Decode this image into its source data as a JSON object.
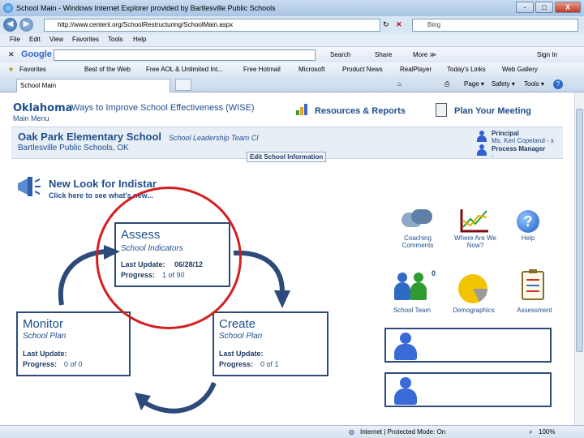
{
  "window": {
    "title": "School Main - Windows Internet Explorer provided by Bartlesville Public Schools",
    "min": "-",
    "max": "□",
    "close": "X"
  },
  "address": {
    "url": "http://www.centerii.org/SchoolRestructuring/SchoolMain.aspx",
    "search_placeholder": "Bing"
  },
  "menu": [
    "File",
    "Edit",
    "View",
    "Favorites",
    "Tools",
    "Help"
  ],
  "google": {
    "label": "Google",
    "search": "Search",
    "share": "Share",
    "more": "More ≫",
    "signin": "Sign In"
  },
  "favorites": {
    "label": "Favorites",
    "items": [
      "Best of the Web",
      "Free AOL & Unlimited Int...",
      "Free Hotmail",
      "Microsoft",
      "Product News",
      "RealPlayer",
      "Today's Links",
      "Web Gallery"
    ]
  },
  "tabs": {
    "active": "School Main",
    "page": "Page ▾",
    "safety": "Safety ▾",
    "tools": "Tools ▾",
    "help": "?"
  },
  "header": {
    "state": "Oklahoma",
    "tagline": "Ways to Improve School Effectiveness (WISE)",
    "main_menu": "Main Menu",
    "resources": "Resources & Reports",
    "plan": "Plan Your Meeting"
  },
  "school": {
    "name": "Oak Park Elementary School",
    "team": "School Leadership Team CI",
    "district": "Bartlesville Public Schools, OK",
    "edit": "Edit School Information",
    "principal_label": "Principal",
    "principal_name": "Ms. Keri Copeland - x",
    "process_manager": "Process Manager",
    "pm_value": "-"
  },
  "new_look": {
    "title": "New Look for Indistar",
    "link": "Click here to see what's new..."
  },
  "assess": {
    "title": "Assess",
    "subtitle": "School Indicators",
    "last_update_label": "Last Update:",
    "last_update": "06/28/12",
    "progress_label": "Progress:",
    "progress": "1 of 90"
  },
  "monitor": {
    "title": "Monitor",
    "subtitle": "School Plan",
    "last_update_label": "Last Update:",
    "last_update": "",
    "progress_label": "Progress:",
    "progress": "0 of 0"
  },
  "create": {
    "title": "Create",
    "subtitle": "School Plan",
    "last_update_label": "Last Update:",
    "last_update": "",
    "progress_label": "Progress:",
    "progress": "0 of 1"
  },
  "tools": {
    "coaching": "Coaching Comments",
    "where": "Where Are We Now?",
    "help": "Help",
    "team": "School Team",
    "team_count": "0",
    "demographics": "Demographics",
    "assessment": "Assessment"
  },
  "status": {
    "zone": "Internet | Protected Mode: On",
    "zoom": "100%"
  },
  "colors": {
    "accent": "#1f4e8c",
    "circle": "#d32020"
  }
}
